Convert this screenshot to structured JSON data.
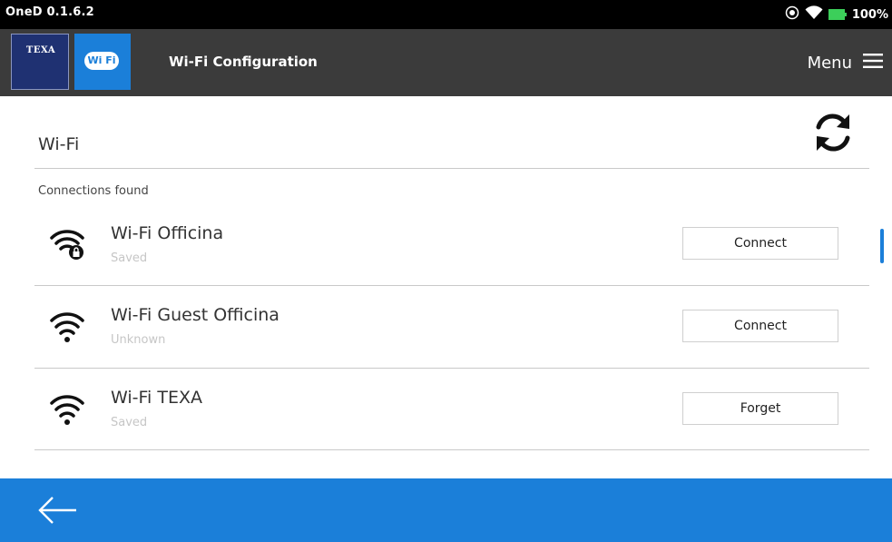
{
  "status_bar": {
    "app_version": "OneD 0.1.6.2",
    "battery_level": "100%"
  },
  "header": {
    "brand_logo_text": "TEXA",
    "app_icon_text": "Wi Fi",
    "title": "Wi-Fi Configuration",
    "menu_label": "Menu"
  },
  "content": {
    "section_title": "Wi-Fi",
    "subheader": "Connections found",
    "networks": [
      {
        "name": "Wi-Fi Officina",
        "status": "Saved",
        "action": "Connect",
        "icon": "wifi-locked-icon"
      },
      {
        "name": "Wi-Fi Guest Officina",
        "status": "Unknown",
        "action": "Connect",
        "icon": "wifi-icon"
      },
      {
        "name": "Wi-Fi TEXA",
        "status": "Saved",
        "action": "Forget",
        "icon": "wifi-icon"
      }
    ]
  },
  "colors": {
    "accent": "#1b7fd9",
    "header_bg": "#3b3b3b",
    "status_bg": "#000000",
    "brand_blue": "#1f3172"
  },
  "icons": {
    "refresh": "refresh-icon",
    "menu": "hamburger-icon",
    "back": "arrow-left-icon"
  }
}
